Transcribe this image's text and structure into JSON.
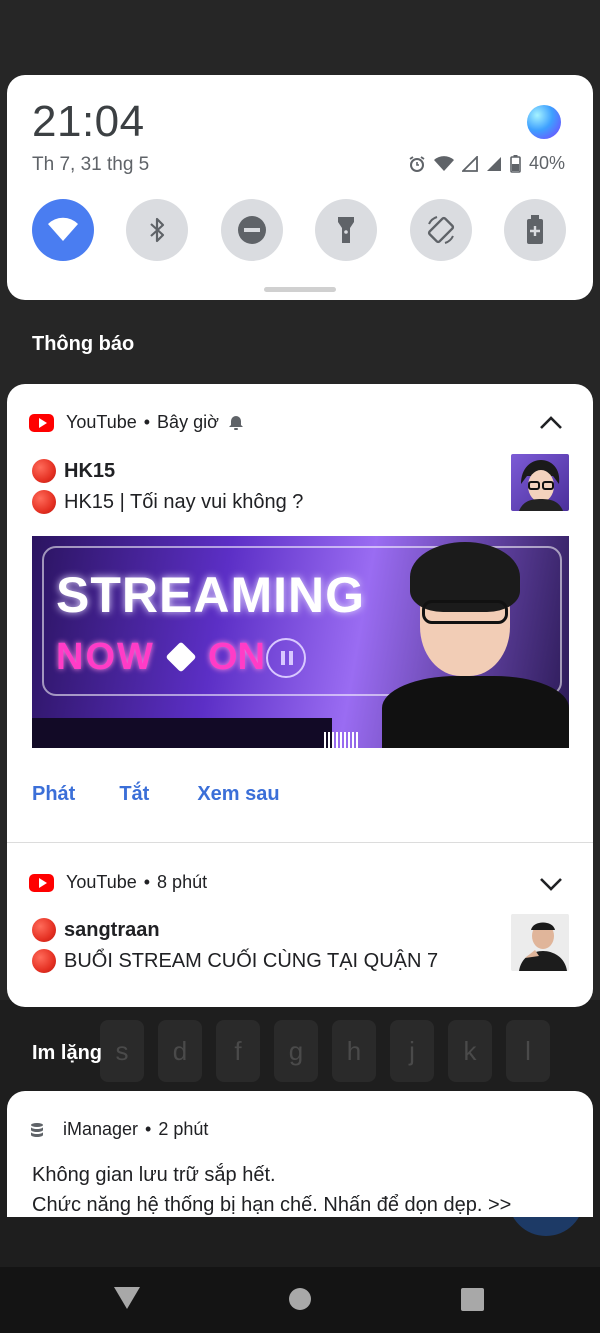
{
  "quick_settings": {
    "time": "21:04",
    "date": "Th 7, 31 thg 5",
    "battery": "40%",
    "tiles": [
      "wifi-icon",
      "bluetooth-icon",
      "dnd-icon",
      "flashlight-icon",
      "auto-rotate-icon",
      "battery-saver-icon"
    ],
    "active_color": "#4a7df1"
  },
  "sections": {
    "notifications": "Thông báo",
    "silent": "Im lặng"
  },
  "keyboard_bg": [
    "s",
    "d",
    "f",
    "g",
    "h",
    "j",
    "k",
    "l"
  ],
  "notif1": {
    "app": "YouTube",
    "time": "Bây giờ",
    "title": "HK15",
    "text": "HK15 | Tối nay vui không ?",
    "banner": {
      "streaming": "STREAMING",
      "now": "NOW",
      "on": "ON"
    },
    "actions": [
      "Phát",
      "Tắt",
      "Xem sau"
    ]
  },
  "notif2": {
    "app": "YouTube",
    "time": "8 phút",
    "title": "sangtraan",
    "text": "BUỔI STREAM CUỐI CÙNG TẠI QUẬN 7"
  },
  "notif3": {
    "app": "iManager",
    "time": "2 phút",
    "title": "Không gian lưu trữ sắp hết.",
    "text": "Chức năng hệ thống bị hạn chế. Nhấn để dọn dẹp. >>"
  },
  "separator": "•"
}
